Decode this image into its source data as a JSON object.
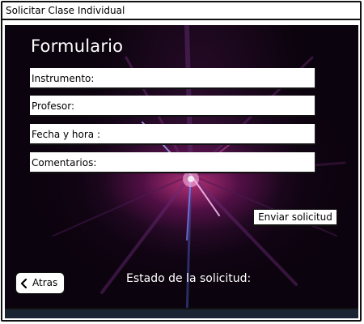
{
  "window": {
    "title": "Solicitar Clase Individual"
  },
  "form": {
    "heading": "Formulario",
    "fields": [
      {
        "label": "Instrumento:"
      },
      {
        "label": "Profesor:"
      },
      {
        "label": "Fecha y hora :"
      },
      {
        "label": "Comentarios:"
      }
    ],
    "submit_label": "Enviar solicitud"
  },
  "status": {
    "label": "Estado de la solicitud:"
  },
  "navigation": {
    "back_label": "Atras",
    "back_icon": "chevron-left-icon"
  },
  "colors": {
    "background": "#0b030d",
    "glow": "#ff4696",
    "text_on_dark": "#ffffff"
  }
}
